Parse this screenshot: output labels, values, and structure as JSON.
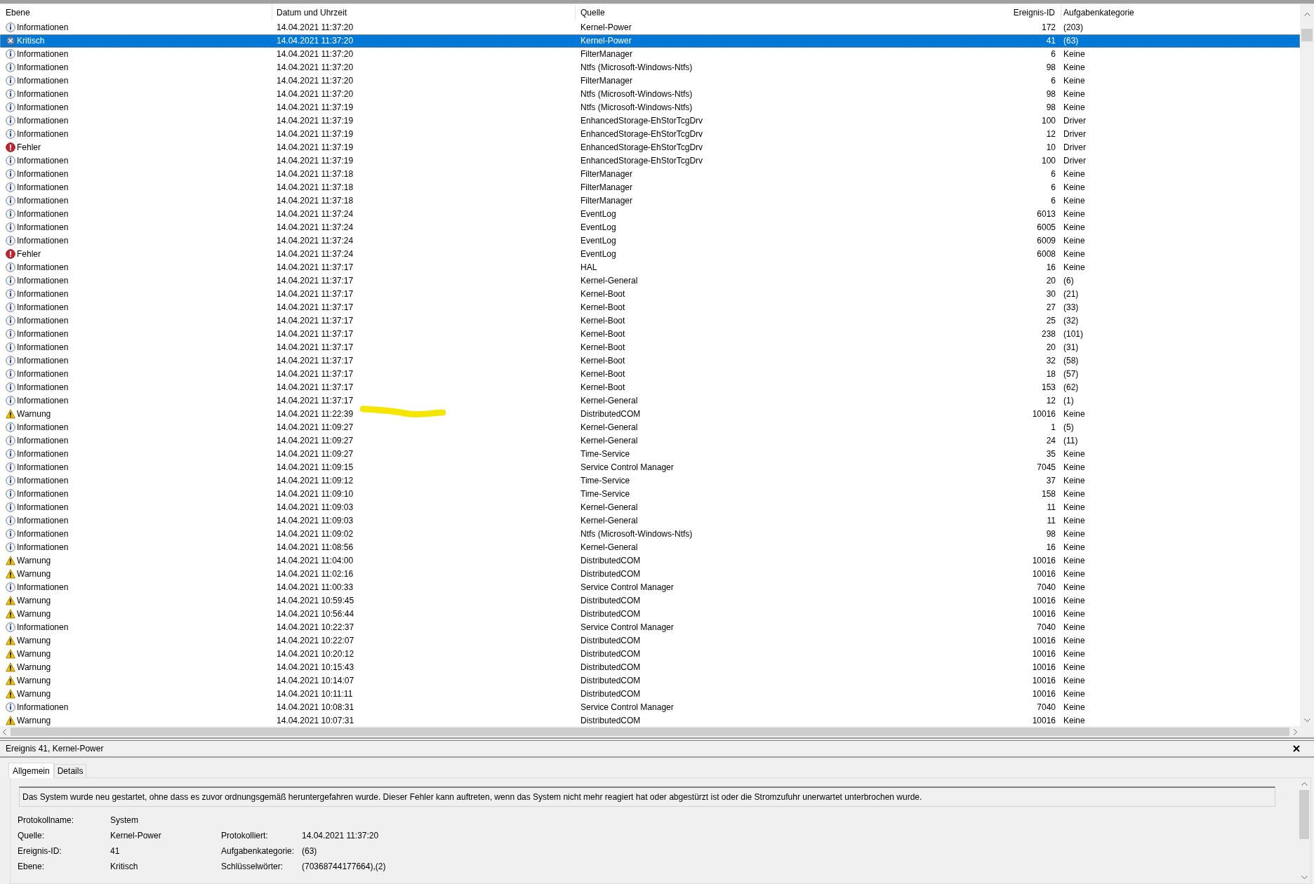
{
  "table": {
    "columns": [
      "Ebene",
      "Datum und Uhrzeit",
      "Quelle",
      "Ereignis-ID",
      "Aufgabenkategorie"
    ],
    "rows": [
      {
        "kind": "info",
        "level": "Informationen",
        "datetime": "14.04.2021 11:37:20",
        "source": "Kernel-Power",
        "id": "172",
        "category": "(203)",
        "selected": false
      },
      {
        "kind": "critical",
        "level": "Kritisch",
        "datetime": "14.04.2021 11:37:20",
        "source": "Kernel-Power",
        "id": "41",
        "category": "(63)",
        "selected": true
      },
      {
        "kind": "info",
        "level": "Informationen",
        "datetime": "14.04.2021 11:37:20",
        "source": "FilterManager",
        "id": "6",
        "category": "Keine",
        "selected": false
      },
      {
        "kind": "info",
        "level": "Informationen",
        "datetime": "14.04.2021 11:37:20",
        "source": "Ntfs (Microsoft-Windows-Ntfs)",
        "id": "98",
        "category": "Keine",
        "selected": false
      },
      {
        "kind": "info",
        "level": "Informationen",
        "datetime": "14.04.2021 11:37:20",
        "source": "FilterManager",
        "id": "6",
        "category": "Keine",
        "selected": false
      },
      {
        "kind": "info",
        "level": "Informationen",
        "datetime": "14.04.2021 11:37:20",
        "source": "Ntfs (Microsoft-Windows-Ntfs)",
        "id": "98",
        "category": "Keine",
        "selected": false
      },
      {
        "kind": "info",
        "level": "Informationen",
        "datetime": "14.04.2021 11:37:19",
        "source": "Ntfs (Microsoft-Windows-Ntfs)",
        "id": "98",
        "category": "Keine",
        "selected": false
      },
      {
        "kind": "info",
        "level": "Informationen",
        "datetime": "14.04.2021 11:37:19",
        "source": "EnhancedStorage-EhStorTcgDrv",
        "id": "100",
        "category": "Driver",
        "selected": false
      },
      {
        "kind": "info",
        "level": "Informationen",
        "datetime": "14.04.2021 11:37:19",
        "source": "EnhancedStorage-EhStorTcgDrv",
        "id": "12",
        "category": "Driver",
        "selected": false
      },
      {
        "kind": "error",
        "level": "Fehler",
        "datetime": "14.04.2021 11:37:19",
        "source": "EnhancedStorage-EhStorTcgDrv",
        "id": "10",
        "category": "Driver",
        "selected": false
      },
      {
        "kind": "info",
        "level": "Informationen",
        "datetime": "14.04.2021 11:37:19",
        "source": "EnhancedStorage-EhStorTcgDrv",
        "id": "100",
        "category": "Driver",
        "selected": false
      },
      {
        "kind": "info",
        "level": "Informationen",
        "datetime": "14.04.2021 11:37:18",
        "source": "FilterManager",
        "id": "6",
        "category": "Keine",
        "selected": false
      },
      {
        "kind": "info",
        "level": "Informationen",
        "datetime": "14.04.2021 11:37:18",
        "source": "FilterManager",
        "id": "6",
        "category": "Keine",
        "selected": false
      },
      {
        "kind": "info",
        "level": "Informationen",
        "datetime": "14.04.2021 11:37:18",
        "source": "FilterManager",
        "id": "6",
        "category": "Keine",
        "selected": false
      },
      {
        "kind": "info",
        "level": "Informationen",
        "datetime": "14.04.2021 11:37:24",
        "source": "EventLog",
        "id": "6013",
        "category": "Keine",
        "selected": false
      },
      {
        "kind": "info",
        "level": "Informationen",
        "datetime": "14.04.2021 11:37:24",
        "source": "EventLog",
        "id": "6005",
        "category": "Keine",
        "selected": false
      },
      {
        "kind": "info",
        "level": "Informationen",
        "datetime": "14.04.2021 11:37:24",
        "source": "EventLog",
        "id": "6009",
        "category": "Keine",
        "selected": false
      },
      {
        "kind": "error",
        "level": "Fehler",
        "datetime": "14.04.2021 11:37:24",
        "source": "EventLog",
        "id": "6008",
        "category": "Keine",
        "selected": false
      },
      {
        "kind": "info",
        "level": "Informationen",
        "datetime": "14.04.2021 11:37:17",
        "source": "HAL",
        "id": "16",
        "category": "Keine",
        "selected": false
      },
      {
        "kind": "info",
        "level": "Informationen",
        "datetime": "14.04.2021 11:37:17",
        "source": "Kernel-General",
        "id": "20",
        "category": "(6)",
        "selected": false
      },
      {
        "kind": "info",
        "level": "Informationen",
        "datetime": "14.04.2021 11:37:17",
        "source": "Kernel-Boot",
        "id": "30",
        "category": "(21)",
        "selected": false
      },
      {
        "kind": "info",
        "level": "Informationen",
        "datetime": "14.04.2021 11:37:17",
        "source": "Kernel-Boot",
        "id": "27",
        "category": "(33)",
        "selected": false
      },
      {
        "kind": "info",
        "level": "Informationen",
        "datetime": "14.04.2021 11:37:17",
        "source": "Kernel-Boot",
        "id": "25",
        "category": "(32)",
        "selected": false
      },
      {
        "kind": "info",
        "level": "Informationen",
        "datetime": "14.04.2021 11:37:17",
        "source": "Kernel-Boot",
        "id": "238",
        "category": "(101)",
        "selected": false
      },
      {
        "kind": "info",
        "level": "Informationen",
        "datetime": "14.04.2021 11:37:17",
        "source": "Kernel-Boot",
        "id": "20",
        "category": "(31)",
        "selected": false
      },
      {
        "kind": "info",
        "level": "Informationen",
        "datetime": "14.04.2021 11:37:17",
        "source": "Kernel-Boot",
        "id": "32",
        "category": "(58)",
        "selected": false
      },
      {
        "kind": "info",
        "level": "Informationen",
        "datetime": "14.04.2021 11:37:17",
        "source": "Kernel-Boot",
        "id": "18",
        "category": "(57)",
        "selected": false
      },
      {
        "kind": "info",
        "level": "Informationen",
        "datetime": "14.04.2021 11:37:17",
        "source": "Kernel-Boot",
        "id": "153",
        "category": "(62)",
        "selected": false
      },
      {
        "kind": "info",
        "level": "Informationen",
        "datetime": "14.04.2021 11:37:17",
        "source": "Kernel-General",
        "id": "12",
        "category": "(1)",
        "selected": false
      },
      {
        "kind": "warning",
        "level": "Warnung",
        "datetime": "14.04.2021 11:22:39",
        "source": "DistributedCOM",
        "id": "10016",
        "category": "Keine",
        "selected": false
      },
      {
        "kind": "info",
        "level": "Informationen",
        "datetime": "14.04.2021 11:09:27",
        "source": "Kernel-General",
        "id": "1",
        "category": "(5)",
        "selected": false
      },
      {
        "kind": "info",
        "level": "Informationen",
        "datetime": "14.04.2021 11:09:27",
        "source": "Kernel-General",
        "id": "24",
        "category": "(11)",
        "selected": false
      },
      {
        "kind": "info",
        "level": "Informationen",
        "datetime": "14.04.2021 11:09:27",
        "source": "Time-Service",
        "id": "35",
        "category": "Keine",
        "selected": false
      },
      {
        "kind": "info",
        "level": "Informationen",
        "datetime": "14.04.2021 11:09:15",
        "source": "Service Control Manager",
        "id": "7045",
        "category": "Keine",
        "selected": false
      },
      {
        "kind": "info",
        "level": "Informationen",
        "datetime": "14.04.2021 11:09:12",
        "source": "Time-Service",
        "id": "37",
        "category": "Keine",
        "selected": false
      },
      {
        "kind": "info",
        "level": "Informationen",
        "datetime": "14.04.2021 11:09:10",
        "source": "Time-Service",
        "id": "158",
        "category": "Keine",
        "selected": false
      },
      {
        "kind": "info",
        "level": "Informationen",
        "datetime": "14.04.2021 11:09:03",
        "source": "Kernel-General",
        "id": "11",
        "category": "Keine",
        "selected": false
      },
      {
        "kind": "info",
        "level": "Informationen",
        "datetime": "14.04.2021 11:09:03",
        "source": "Kernel-General",
        "id": "11",
        "category": "Keine",
        "selected": false
      },
      {
        "kind": "info",
        "level": "Informationen",
        "datetime": "14.04.2021 11:09:02",
        "source": "Ntfs (Microsoft-Windows-Ntfs)",
        "id": "98",
        "category": "Keine",
        "selected": false
      },
      {
        "kind": "info",
        "level": "Informationen",
        "datetime": "14.04.2021 11:08:56",
        "source": "Kernel-General",
        "id": "16",
        "category": "Keine",
        "selected": false
      },
      {
        "kind": "warning",
        "level": "Warnung",
        "datetime": "14.04.2021 11:04:00",
        "source": "DistributedCOM",
        "id": "10016",
        "category": "Keine",
        "selected": false
      },
      {
        "kind": "warning",
        "level": "Warnung",
        "datetime": "14.04.2021 11:02:16",
        "source": "DistributedCOM",
        "id": "10016",
        "category": "Keine",
        "selected": false
      },
      {
        "kind": "info",
        "level": "Informationen",
        "datetime": "14.04.2021 11:00:33",
        "source": "Service Control Manager",
        "id": "7040",
        "category": "Keine",
        "selected": false
      },
      {
        "kind": "warning",
        "level": "Warnung",
        "datetime": "14.04.2021 10:59:45",
        "source": "DistributedCOM",
        "id": "10016",
        "category": "Keine",
        "selected": false
      },
      {
        "kind": "warning",
        "level": "Warnung",
        "datetime": "14.04.2021 10:56:44",
        "source": "DistributedCOM",
        "id": "10016",
        "category": "Keine",
        "selected": false
      },
      {
        "kind": "info",
        "level": "Informationen",
        "datetime": "14.04.2021 10:22:37",
        "source": "Service Control Manager",
        "id": "7040",
        "category": "Keine",
        "selected": false
      },
      {
        "kind": "warning",
        "level": "Warnung",
        "datetime": "14.04.2021 10:22:07",
        "source": "DistributedCOM",
        "id": "10016",
        "category": "Keine",
        "selected": false
      },
      {
        "kind": "warning",
        "level": "Warnung",
        "datetime": "14.04.2021 10:20:12",
        "source": "DistributedCOM",
        "id": "10016",
        "category": "Keine",
        "selected": false
      },
      {
        "kind": "warning",
        "level": "Warnung",
        "datetime": "14.04.2021 10:15:43",
        "source": "DistributedCOM",
        "id": "10016",
        "category": "Keine",
        "selected": false
      },
      {
        "kind": "warning",
        "level": "Warnung",
        "datetime": "14.04.2021 10:14:07",
        "source": "DistributedCOM",
        "id": "10016",
        "category": "Keine",
        "selected": false
      },
      {
        "kind": "warning",
        "level": "Warnung",
        "datetime": "14.04.2021 10:11:11",
        "source": "DistributedCOM",
        "id": "10016",
        "category": "Keine",
        "selected": false
      },
      {
        "kind": "info",
        "level": "Informationen",
        "datetime": "14.04.2021 10:08:31",
        "source": "Service Control Manager",
        "id": "7040",
        "category": "Keine",
        "selected": false
      },
      {
        "kind": "warning",
        "level": "Warnung",
        "datetime": "14.04.2021 10:07:31",
        "source": "DistributedCOM",
        "id": "10016",
        "category": "Keine",
        "selected": false
      }
    ]
  },
  "details": {
    "title": "Ereignis 41, Kernel-Power",
    "tabs": [
      {
        "label": "Allgemein",
        "selected": true
      },
      {
        "label": "Details",
        "selected": false
      }
    ],
    "description": "Das System wurde neu gestartet, ohne dass es zuvor ordnungsgemäß heruntergefahren wurde. Dieser Fehler kann auftreten, wenn das System nicht mehr reagiert hat oder abgestürzt ist oder die Stromzufuhr unerwartet unterbrochen wurde.",
    "field_rows": [
      [
        {
          "label": "Protokollname:",
          "value": "System"
        }
      ],
      [
        {
          "label": "Quelle:",
          "value": "Kernel-Power"
        },
        {
          "label": "Protokolliert:",
          "value": "14.04.2021 11:37:20"
        }
      ],
      [
        {
          "label": "Ereignis-ID:",
          "value": "41"
        },
        {
          "label": "Aufgabenkategorie:",
          "value": "(63)"
        }
      ],
      [
        {
          "label": "Ebene:",
          "value": "Kritisch"
        },
        {
          "label": "Schlüsselwörter:",
          "value": "(70368744177664),(2)"
        }
      ]
    ]
  }
}
